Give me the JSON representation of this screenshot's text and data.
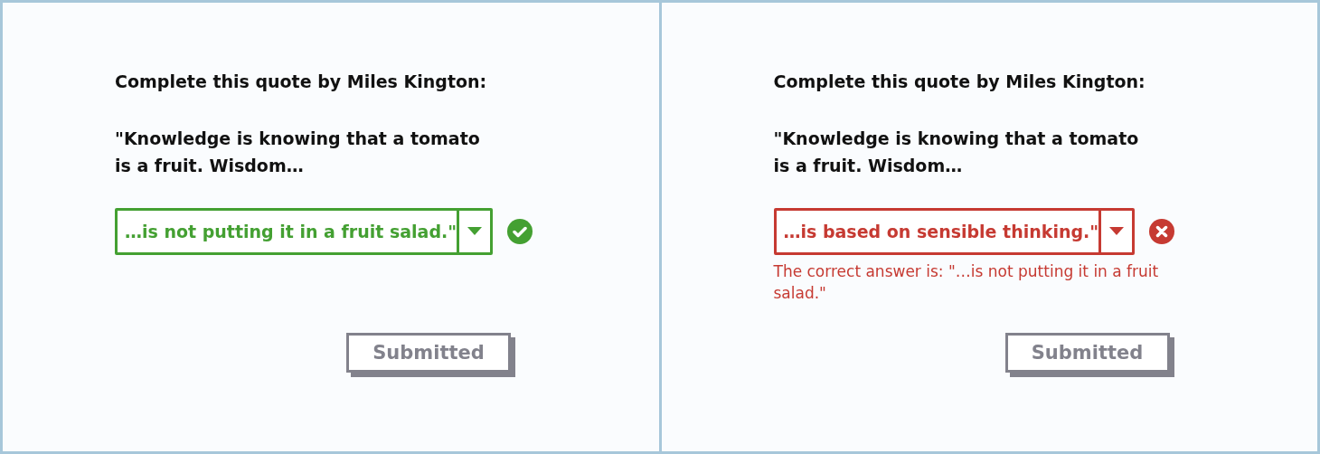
{
  "panels": [
    {
      "prompt": "Complete this quote by Miles Kington:",
      "quote": "\"Knowledge is knowing that a tomato is a fruit. Wisdom…",
      "answer": {
        "value": "…is not putting it in a fruit salad.\"",
        "correct": true
      },
      "button": {
        "label": "Submitted",
        "disabled": true
      }
    },
    {
      "prompt": "Complete this quote by Miles Kington:",
      "quote": "\"Knowledge is knowing that a tomato is a fruit. Wisdom…",
      "answer": {
        "value": "…is based on sensible thinking.\"",
        "correct": false
      },
      "feedback": "The correct answer is: \"…is not putting it in a fruit salad.\"",
      "button": {
        "label": "Submitted",
        "disabled": true
      }
    }
  ]
}
